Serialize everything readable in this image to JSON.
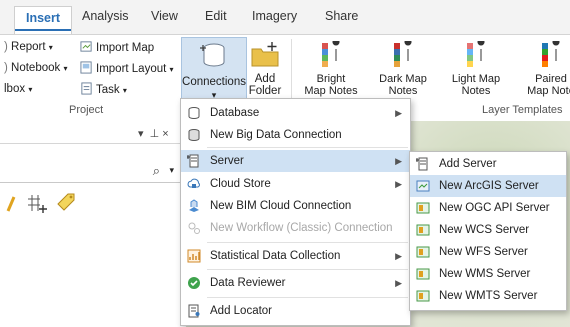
{
  "tabs": [
    "Insert",
    "Analysis",
    "View",
    "Edit",
    "Imagery",
    "Share"
  ],
  "ribbon": {
    "report": "Report",
    "notebook": "Notebook",
    "toolbox": "lbox",
    "import_map": "Import Map",
    "import_layout": "Import Layout",
    "task": "Task",
    "project_group": "Project",
    "connections": "Connections",
    "add_folder": [
      "Add",
      "Folder"
    ],
    "templates": [
      {
        "name": [
          "Bright",
          "Map Notes"
        ],
        "colors": [
          "#d9534f",
          "#4a90d9",
          "#5cb85c",
          "#f0ad4e"
        ]
      },
      {
        "name": [
          "Dark Map",
          "Notes"
        ],
        "colors": [
          "#c9302c",
          "#3a6fb0",
          "#2e8b57",
          "#e6a23c"
        ]
      },
      {
        "name": [
          "Light Map",
          "Notes"
        ],
        "colors": [
          "#e57373",
          "#64b5f6",
          "#81c784",
          "#ffd54f"
        ]
      },
      {
        "name": [
          "Paired",
          "Map Note"
        ],
        "colors": [
          "#1f78b4",
          "#33a02c",
          "#e31a1c",
          "#ff7f00"
        ]
      }
    ],
    "layer_templates_group": "Layer Templates"
  },
  "pane": {
    "pin": "←  ×",
    "search_icon": "⌕"
  },
  "menu1": [
    {
      "label": "Database",
      "icon": "database-icon",
      "arrow": true
    },
    {
      "label": "New Big Data Connection",
      "icon": "big-data-icon",
      "arrow": false
    },
    {
      "label": "Server",
      "icon": "server-icon",
      "arrow": true,
      "highlight": true
    },
    {
      "label": "Cloud Store",
      "icon": "cloud-store-icon",
      "arrow": true
    },
    {
      "label": "New BIM Cloud Connection",
      "icon": "bim-icon",
      "arrow": false
    },
    {
      "label": "New Workflow (Classic) Connection",
      "icon": "workflow-icon",
      "arrow": false,
      "disabled": true
    },
    {
      "label": "Statistical Data Collection",
      "icon": "statistics-icon",
      "arrow": true
    },
    {
      "label": "Data Reviewer",
      "icon": "check-icon",
      "arrow": true
    },
    {
      "label": "Add Locator",
      "icon": "locator-icon",
      "arrow": false
    }
  ],
  "menu2": [
    {
      "label": "Add Server",
      "icon": "add-server-icon"
    },
    {
      "label": "New ArcGIS Server",
      "icon": "arcgis-server-icon",
      "highlight": true
    },
    {
      "label": "New OGC API Server",
      "icon": "ogc-icon"
    },
    {
      "label": "New WCS Server",
      "icon": "wcs-icon"
    },
    {
      "label": "New WFS Server",
      "icon": "wfs-icon"
    },
    {
      "label": "New WMS Server",
      "icon": "wms-icon"
    },
    {
      "label": "New WMTS Server",
      "icon": "wmts-icon"
    }
  ]
}
